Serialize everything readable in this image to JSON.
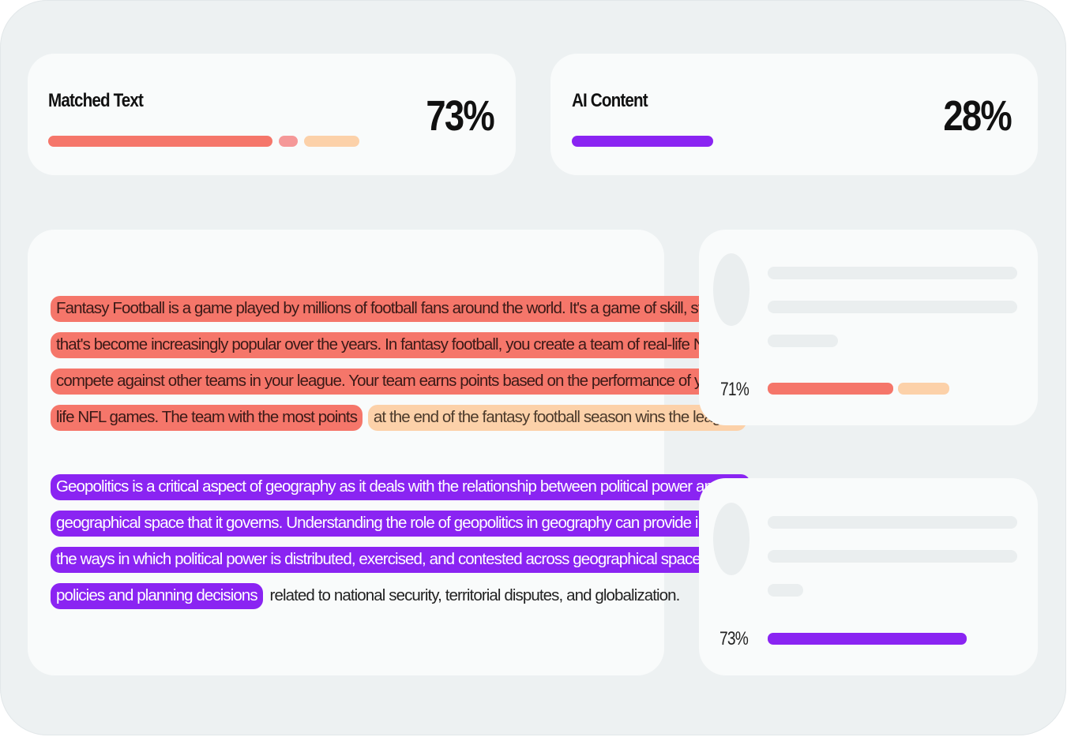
{
  "matched_text": {
    "title": "Matched Text",
    "percent": "73%",
    "bar_colors": [
      "#f5766a",
      "#f59898",
      "#fcd1a9"
    ]
  },
  "ai_content": {
    "title": "AI Content",
    "percent": "28%",
    "bar_color": "#8a24f2"
  },
  "document": {
    "paragraph1": {
      "line1": "Fantasy Football is a game played by millions of football fans around the world. It's a game of skill, strategy and luck",
      "line2": "that's become increasingly popular over the years. In fantasy football, you create a team of real-life NFL players and",
      "line3": "compete against other teams in your league. Your team earns points based on the performance of your players in real-",
      "line4_matched": "life NFL games. The team with the most points",
      "line4_partial": "at the end of the fantasy football season wins the league."
    },
    "paragraph2": {
      "line1": "Geopolitics is a critical aspect of geography as it deals with the relationship between political power and the",
      "line2": "geographical space that it governs. Understanding the role of geopolitics in geography can provide insight into",
      "line3": "the ways in which political power is distributed, exercised, and contested across geographical space, and inform",
      "line4_ai": "policies and planning decisions",
      "line4_plain": "related to national security, territorial disputes, and globalization."
    }
  },
  "sources": [
    {
      "percent": "71%",
      "bar_colors": [
        "#f5766a",
        "#fcd1a9"
      ]
    },
    {
      "percent": "73%",
      "bar_colors": [
        "#8a24f2"
      ]
    }
  ]
}
